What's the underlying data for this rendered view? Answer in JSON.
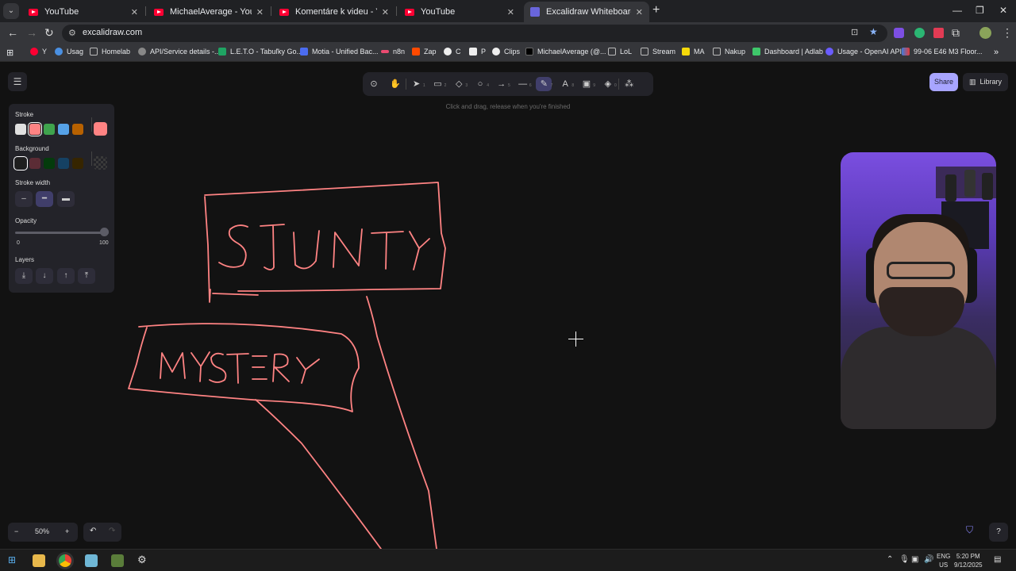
{
  "browser": {
    "tabs": [
      {
        "title": "YouTube"
      },
      {
        "title": "MichaelAverage - YouTube"
      },
      {
        "title": "Komentáre k videu - YouTube S"
      },
      {
        "title": "YouTube"
      },
      {
        "title": "Excalidraw Whiteboard"
      }
    ],
    "url": "excalidraw.com",
    "bookmarks": [
      "Y",
      "Usag",
      "Homelab",
      "API/Service details -...",
      "L.E.T.O - Tabuľky Go...",
      "Motia - Unified Bac...",
      "n8n",
      "Zap",
      "C",
      "P",
      "Clips",
      "MichaelAverage (@...",
      "LoL",
      "Stream",
      "MA",
      "Nakup",
      "Dashboard | Adlab",
      "Usage - OpenAI API",
      "99-06 E46 M3 Floor..."
    ]
  },
  "toolbar": {
    "hint": "Click and drag, release when you're finished",
    "tools": [
      {
        "name": "lock",
        "glyph": "⊙",
        "key": ""
      },
      {
        "name": "hand",
        "glyph": "✋",
        "key": ""
      },
      {
        "name": "selection",
        "glyph": "➤",
        "key": "1"
      },
      {
        "name": "rectangle",
        "glyph": "▭",
        "key": "2"
      },
      {
        "name": "diamond",
        "glyph": "◇",
        "key": "3"
      },
      {
        "name": "ellipse",
        "glyph": "○",
        "key": "4"
      },
      {
        "name": "arrow",
        "glyph": "→",
        "key": "5"
      },
      {
        "name": "line",
        "glyph": "—",
        "key": "6"
      },
      {
        "name": "pencil",
        "glyph": "✎",
        "key": "7"
      },
      {
        "name": "text",
        "glyph": "A",
        "key": "8"
      },
      {
        "name": "image",
        "glyph": "▣",
        "key": "9"
      },
      {
        "name": "eraser",
        "glyph": "◈",
        "key": "0"
      },
      {
        "name": "more",
        "glyph": "⁂",
        "key": ""
      }
    ],
    "share_label": "Share",
    "library_label": "Library"
  },
  "properties": {
    "stroke_label": "Stroke",
    "stroke_colors": [
      "#e0e0e0",
      "#ff8383",
      "#3fa34d",
      "#56a2e8",
      "#b76100"
    ],
    "stroke_selected": "#ff8383",
    "background_label": "Background",
    "background_colors": [
      "#1e1e1e",
      "#5b2c35",
      "#043b0c",
      "#154163",
      "#362500"
    ],
    "stroke_width_label": "Stroke width",
    "opacity_label": "Opacity",
    "opacity_min": "0",
    "opacity_max": "100",
    "opacity_value": 100,
    "layers_label": "Layers"
  },
  "canvas": {
    "stroke_color": "#ff8383",
    "words": [
      "STUNTY",
      "MYSTERY"
    ]
  },
  "footer": {
    "zoom": "50%"
  },
  "taskbar": {
    "lang": "ENG",
    "region": "US",
    "time": "5:20 PM",
    "date": "9/12/2025"
  }
}
